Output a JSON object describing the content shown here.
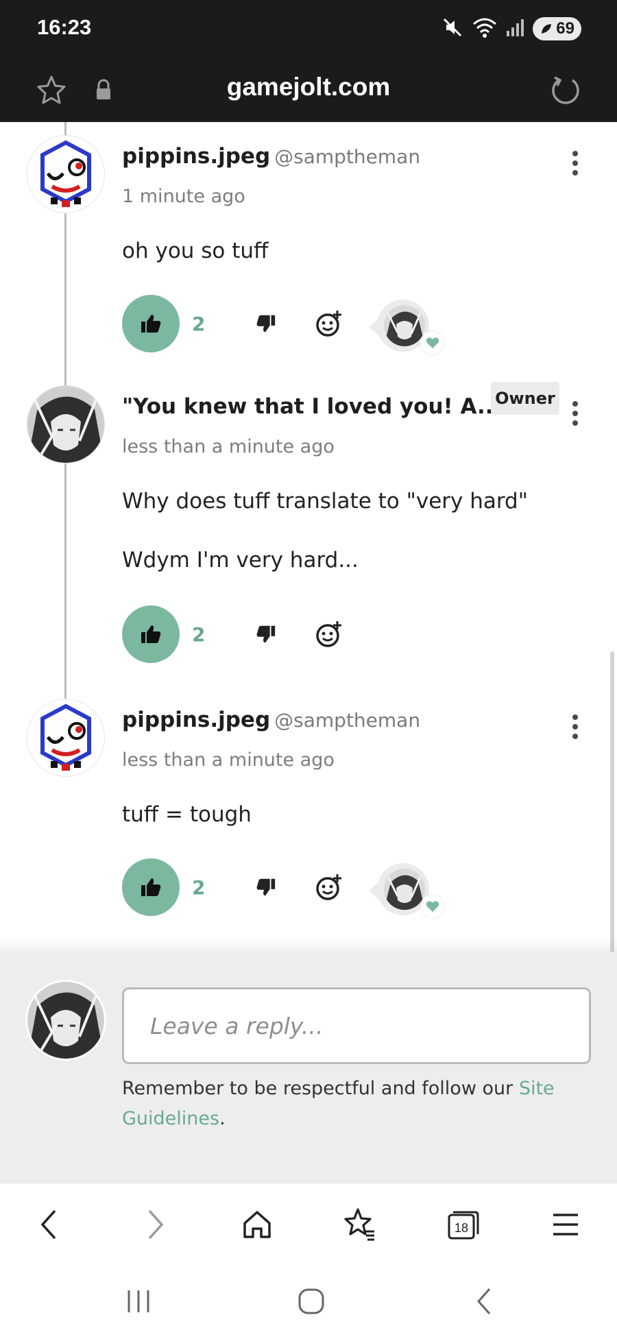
{
  "status_bar": {
    "time": "16:23",
    "battery_level": "69",
    "icons": [
      "mute-icon",
      "wifi-icon",
      "signal-icon",
      "battery-icon"
    ]
  },
  "browser": {
    "url": "gamejolt.com",
    "tab_count": "18"
  },
  "comments": [
    {
      "author": "pippins.jpeg",
      "handle": "@samptheman",
      "time": "1 minute ago",
      "text": [
        "oh you so tuff"
      ],
      "likes": "2",
      "owner_liked": true
    },
    {
      "author": "\"You knew that I loved you! A...",
      "badge": "Owner",
      "time": "less than a minute ago",
      "text": [
        "Why does tuff translate to \"very hard\"",
        "Wdym I'm very hard..."
      ],
      "likes": "2",
      "owner_liked": false
    },
    {
      "author": "pippins.jpeg",
      "handle": "@samptheman",
      "time": "less than a minute ago",
      "text": [
        "tuff = tough"
      ],
      "likes": "2",
      "owner_liked": true
    }
  ],
  "reply": {
    "placeholder": "Leave a reply...",
    "note_prefix": "Remember to be respectful and follow our ",
    "note_link": "Site Guidelines",
    "note_suffix": "."
  },
  "colors": {
    "accent": "#7cb8a0",
    "accent_text": "#6aaa90",
    "dark_bar": "#1b1b1b"
  }
}
